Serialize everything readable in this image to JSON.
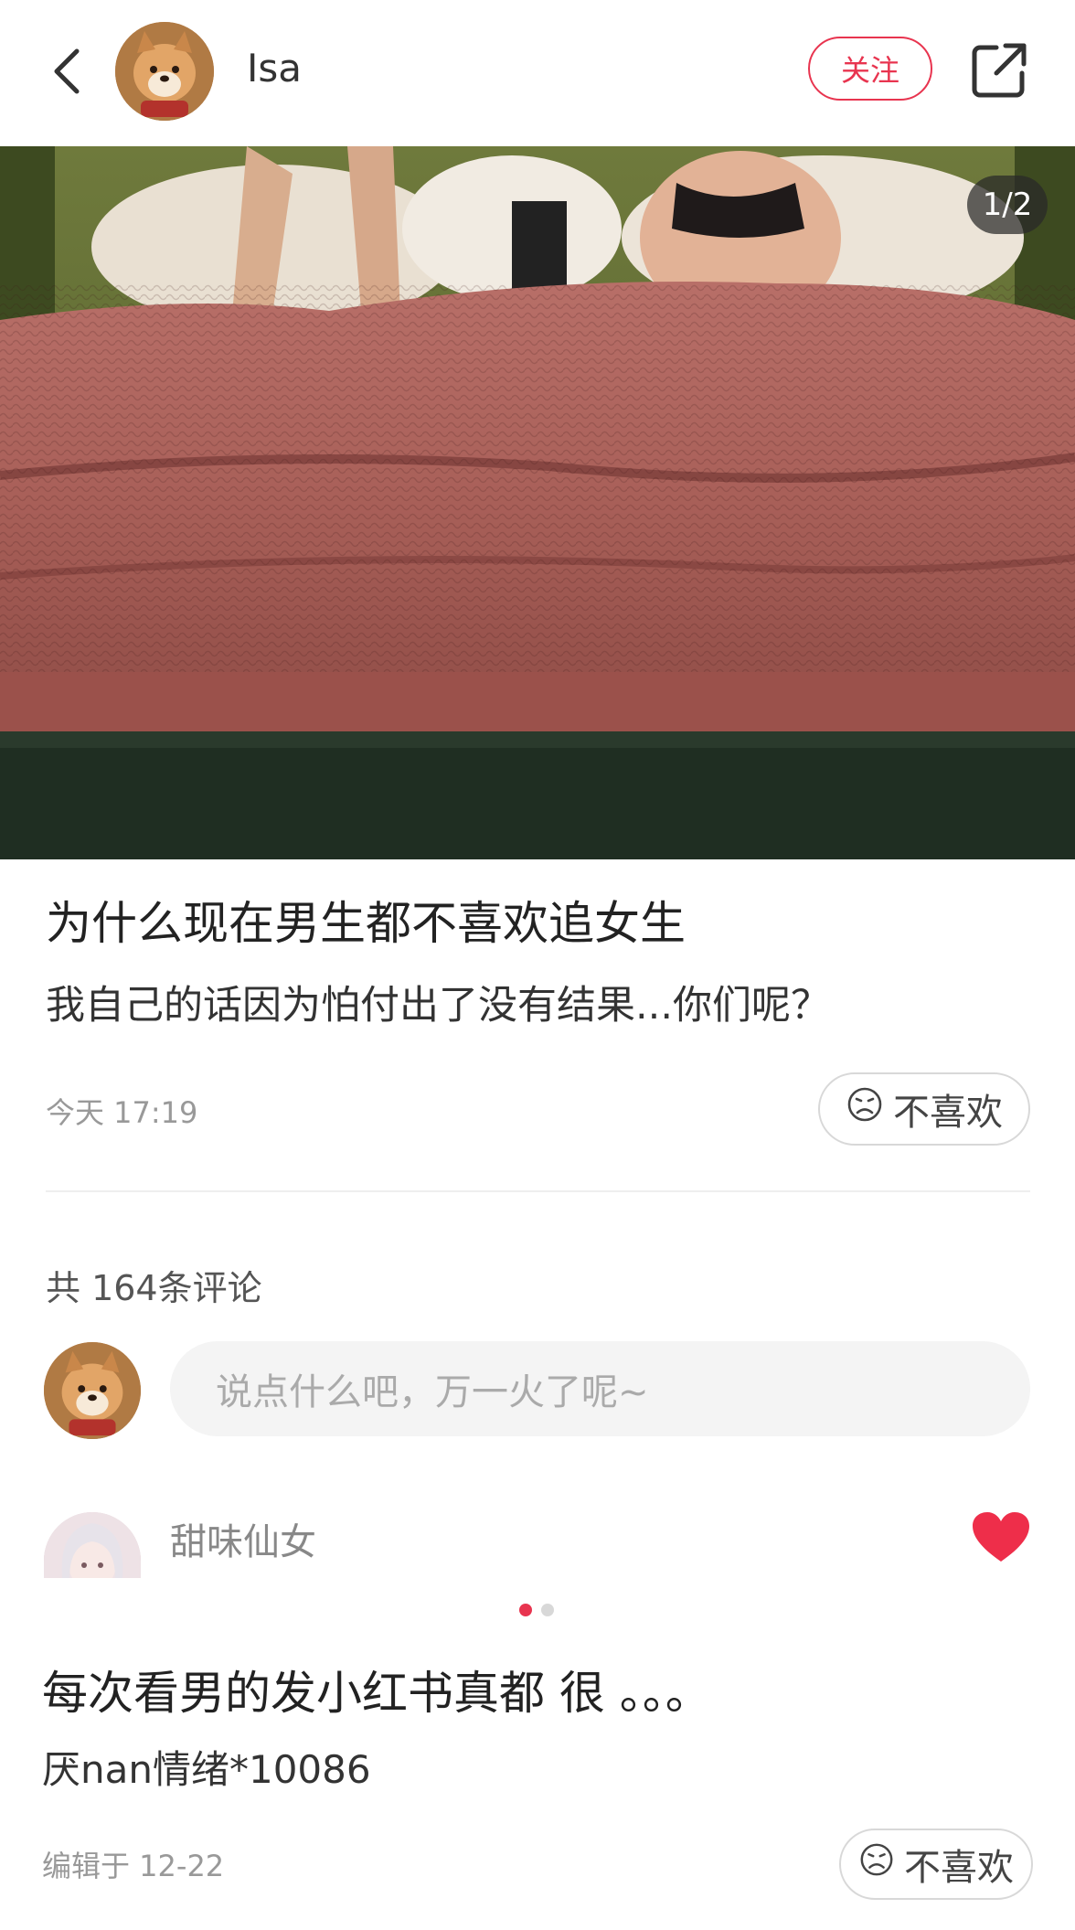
{
  "header": {
    "back_icon": "back-arrow-icon",
    "username": "Isa",
    "follow_label": "关注",
    "share_icon": "share-icon",
    "accent_color": "#e8344f"
  },
  "image": {
    "page_counter": "1/2"
  },
  "post": {
    "title": "为什么现在男生都不喜欢追女生",
    "body": "我自己的话因为怕付出了没有结果...你们呢？",
    "time": "今天 17:19",
    "dislike_label": "不喜欢"
  },
  "comments": {
    "count_label": "共 164条评论",
    "input_placeholder": "说点什么吧，万一火了呢~",
    "first_comment": {
      "author": "甜味仙女",
      "liked_icon": "heart-filled-icon"
    }
  },
  "carousel": {
    "total_dots": 2,
    "active_index": 0
  },
  "second_post": {
    "title": "每次看男的发小红书真都 很 。。。",
    "body": "厌nan情绪*10086",
    "edited": "编辑于 12-22",
    "dislike_label": "不喜欢"
  }
}
